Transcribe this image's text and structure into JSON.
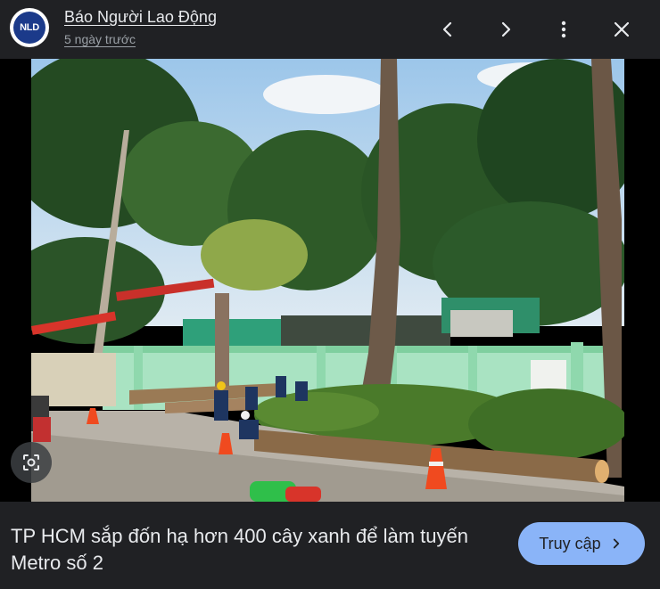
{
  "header": {
    "logo_text": "NLD",
    "source_name": "Báo Người Lao Động",
    "time_ago": "5 ngày trước",
    "icons": [
      "chevron-left-icon",
      "chevron-right-icon",
      "more-vert-icon",
      "close-icon"
    ]
  },
  "image": {
    "description_icons": [
      "lens-icon"
    ]
  },
  "footer": {
    "headline": "TP HCM sắp đốn hạ hơn 400 cây xanh để làm tuyến Metro số 2",
    "visit_label": "Truy cập"
  },
  "colors": {
    "bar_bg": "#202124",
    "accent": "#8ab4f8",
    "text": "#e8eaed",
    "muted": "#9aa0a6"
  }
}
